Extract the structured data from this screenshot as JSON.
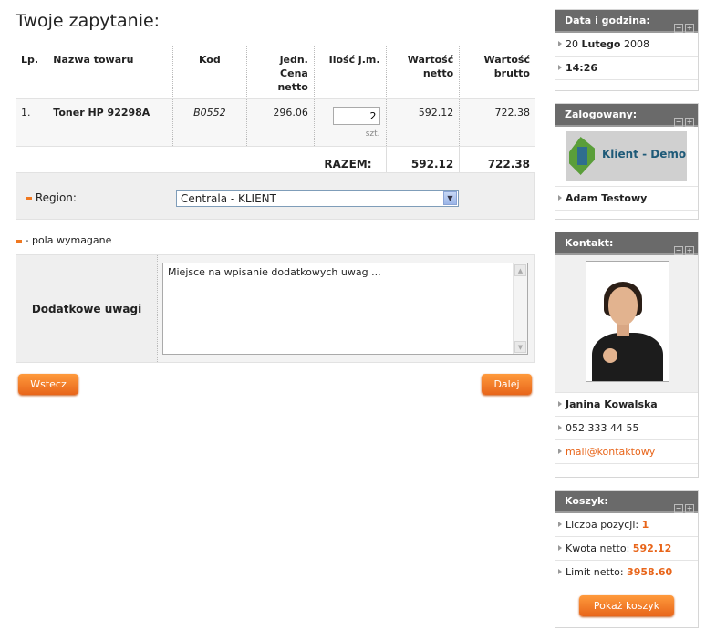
{
  "main": {
    "title": "Twoje zapytanie:",
    "table": {
      "headers": {
        "lp": "Lp.",
        "name": "Nazwa towaru",
        "code": "Kod",
        "unit_price": "jedn. Cena netto",
        "qty": "Ilość j.m.",
        "net": "Wartość netto",
        "gross": "Wartość brutto"
      },
      "rows": [
        {
          "lp": "1.",
          "name": "Toner HP 92298A",
          "code": "B0552",
          "unit_price": "296.06",
          "qty": "2",
          "unit": "szt.",
          "net": "592.12",
          "gross": "722.38"
        }
      ],
      "total_label": "RAZEM:",
      "total_net": "592.12",
      "total_gross": "722.38"
    },
    "region": {
      "label": "Region:",
      "selected": "Centrala - KLIENT"
    },
    "required_note": "- pola wymagane",
    "notes": {
      "label": "Dodatkowe uwagi",
      "placeholder": "Miejsce na wpisanie dodatkowych uwag ..."
    },
    "buttons": {
      "back": "Wstecz",
      "next": "Dalej"
    }
  },
  "sidebar": {
    "datetime": {
      "title": "Data i godzina:",
      "day": "20",
      "month": "Lutego",
      "year": "2008",
      "time": "14:26"
    },
    "logged": {
      "title": "Zalogowany:",
      "logo_text": "Klient - Demo",
      "user": "Adam Testowy"
    },
    "contact": {
      "title": "Kontakt:",
      "name": "Janina Kowalska",
      "phone": "052 333 44 55",
      "email": "mail@kontaktowy"
    },
    "cart": {
      "title": "Koszyk:",
      "items_label": "Liczba pozycji:",
      "items_value": "1",
      "net_label": "Kwota netto:",
      "net_value": "592.12",
      "limit_label": "Limit netto:",
      "limit_value": "3958.60",
      "button": "Pokaż koszyk"
    }
  },
  "colors": {
    "accent": "#f07820",
    "header_bg": "#6a6a6a"
  }
}
